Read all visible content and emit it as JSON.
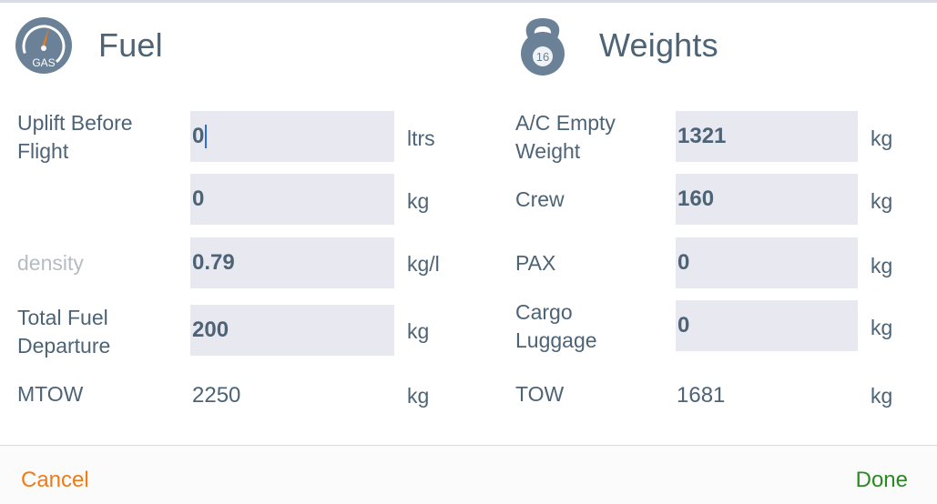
{
  "fuel": {
    "title": "Fuel",
    "icon": "gas-gauge-icon",
    "icon_text": "GAS",
    "uplift_label": "Uplift Before Flight",
    "uplift_value": "0",
    "uplift_unit": "ltrs",
    "uplift_kg_value": "0",
    "uplift_kg_unit": "kg",
    "density_label": "density",
    "density_value": "0.79",
    "density_unit": "kg/l",
    "total_fuel_label": "Total Fuel Departure",
    "total_fuel_value": "200",
    "total_fuel_unit": "kg",
    "mtow_label": "MTOW",
    "mtow_value": "2250",
    "mtow_unit": "kg"
  },
  "weights": {
    "title": "Weights",
    "icon": "kettlebell-icon",
    "icon_text": "16",
    "empty_weight_label": "A/C Empty Weight",
    "empty_weight_value": "1321",
    "empty_weight_unit": "kg",
    "crew_label": "Crew",
    "crew_value": "160",
    "crew_unit": "kg",
    "pax_label": "PAX",
    "pax_value": "0",
    "pax_unit": "kg",
    "cargo_label": "Cargo Luggage",
    "cargo_value": "0",
    "cargo_unit": "kg",
    "tow_label": "TOW",
    "tow_value": "1681",
    "tow_unit": "kg"
  },
  "footer": {
    "cancel_label": "Cancel",
    "done_label": "Done"
  },
  "colors": {
    "cancel": "#f27b12",
    "done": "#2a8a22",
    "text": "#4d6376",
    "field_bg": "#e7e8f0",
    "caret": "#2b6ae8"
  }
}
